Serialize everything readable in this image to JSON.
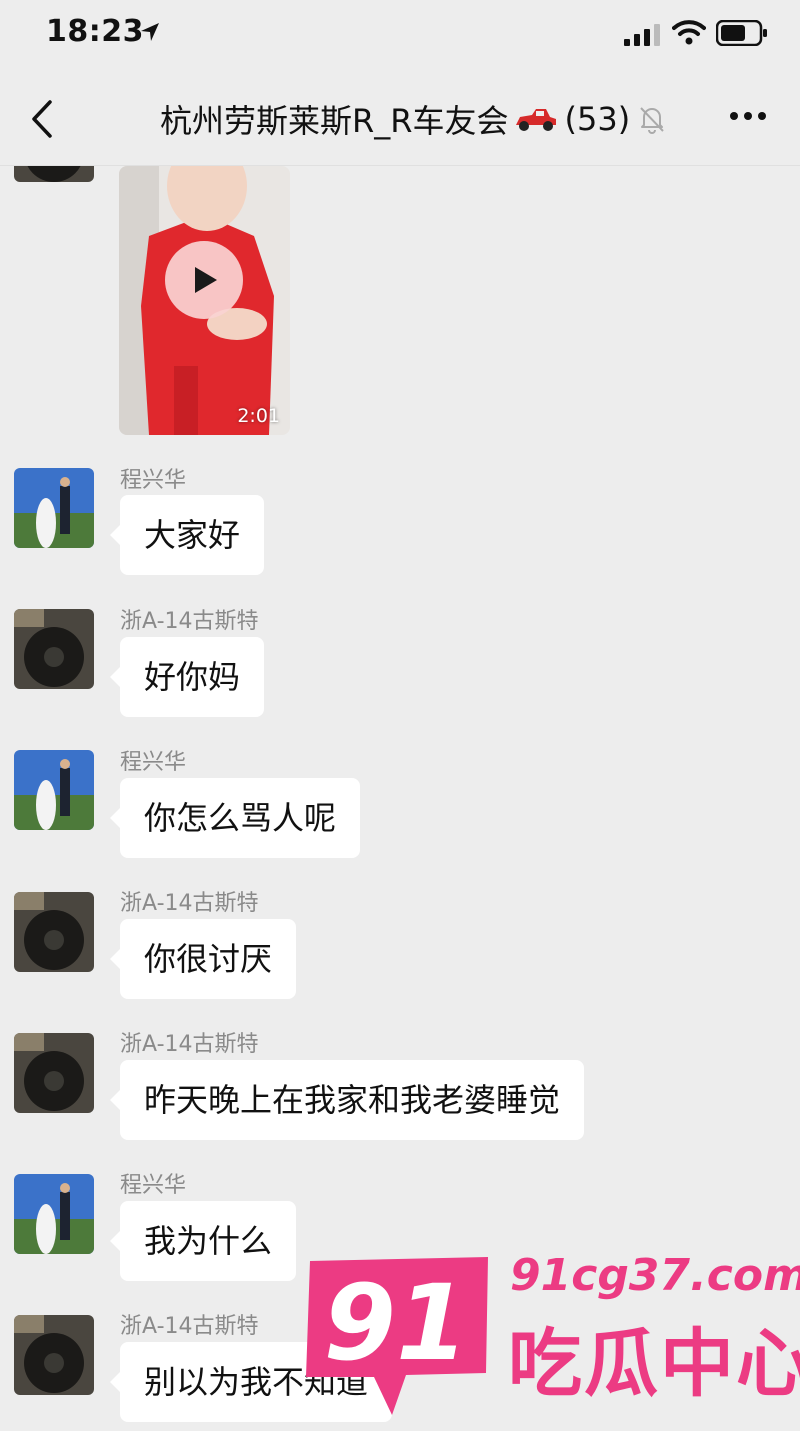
{
  "status_bar": {
    "time": "18:23"
  },
  "header": {
    "title": "杭州劳斯莱斯R_R车友会",
    "member_count": "(53)"
  },
  "video": {
    "duration": "2:01"
  },
  "messages": [
    {
      "sender": "程兴华",
      "text": "大家好"
    },
    {
      "sender": "浙A-14古斯特",
      "text": "好你妈"
    },
    {
      "sender": "程兴华",
      "text": "你怎么骂人呢"
    },
    {
      "sender": "浙A-14古斯特",
      "text": "你很讨厌"
    },
    {
      "sender": "浙A-14古斯特",
      "text": "昨天晚上在我家和我老婆睡觉"
    },
    {
      "sender": "程兴华",
      "text": "我为什么"
    },
    {
      "sender": "浙A-14古斯特",
      "text": "别以为我不知道"
    }
  ],
  "watermark": {
    "number": "91",
    "site": "91cg37.com",
    "name": "吃瓜中心",
    "color": "#ec3b83"
  }
}
